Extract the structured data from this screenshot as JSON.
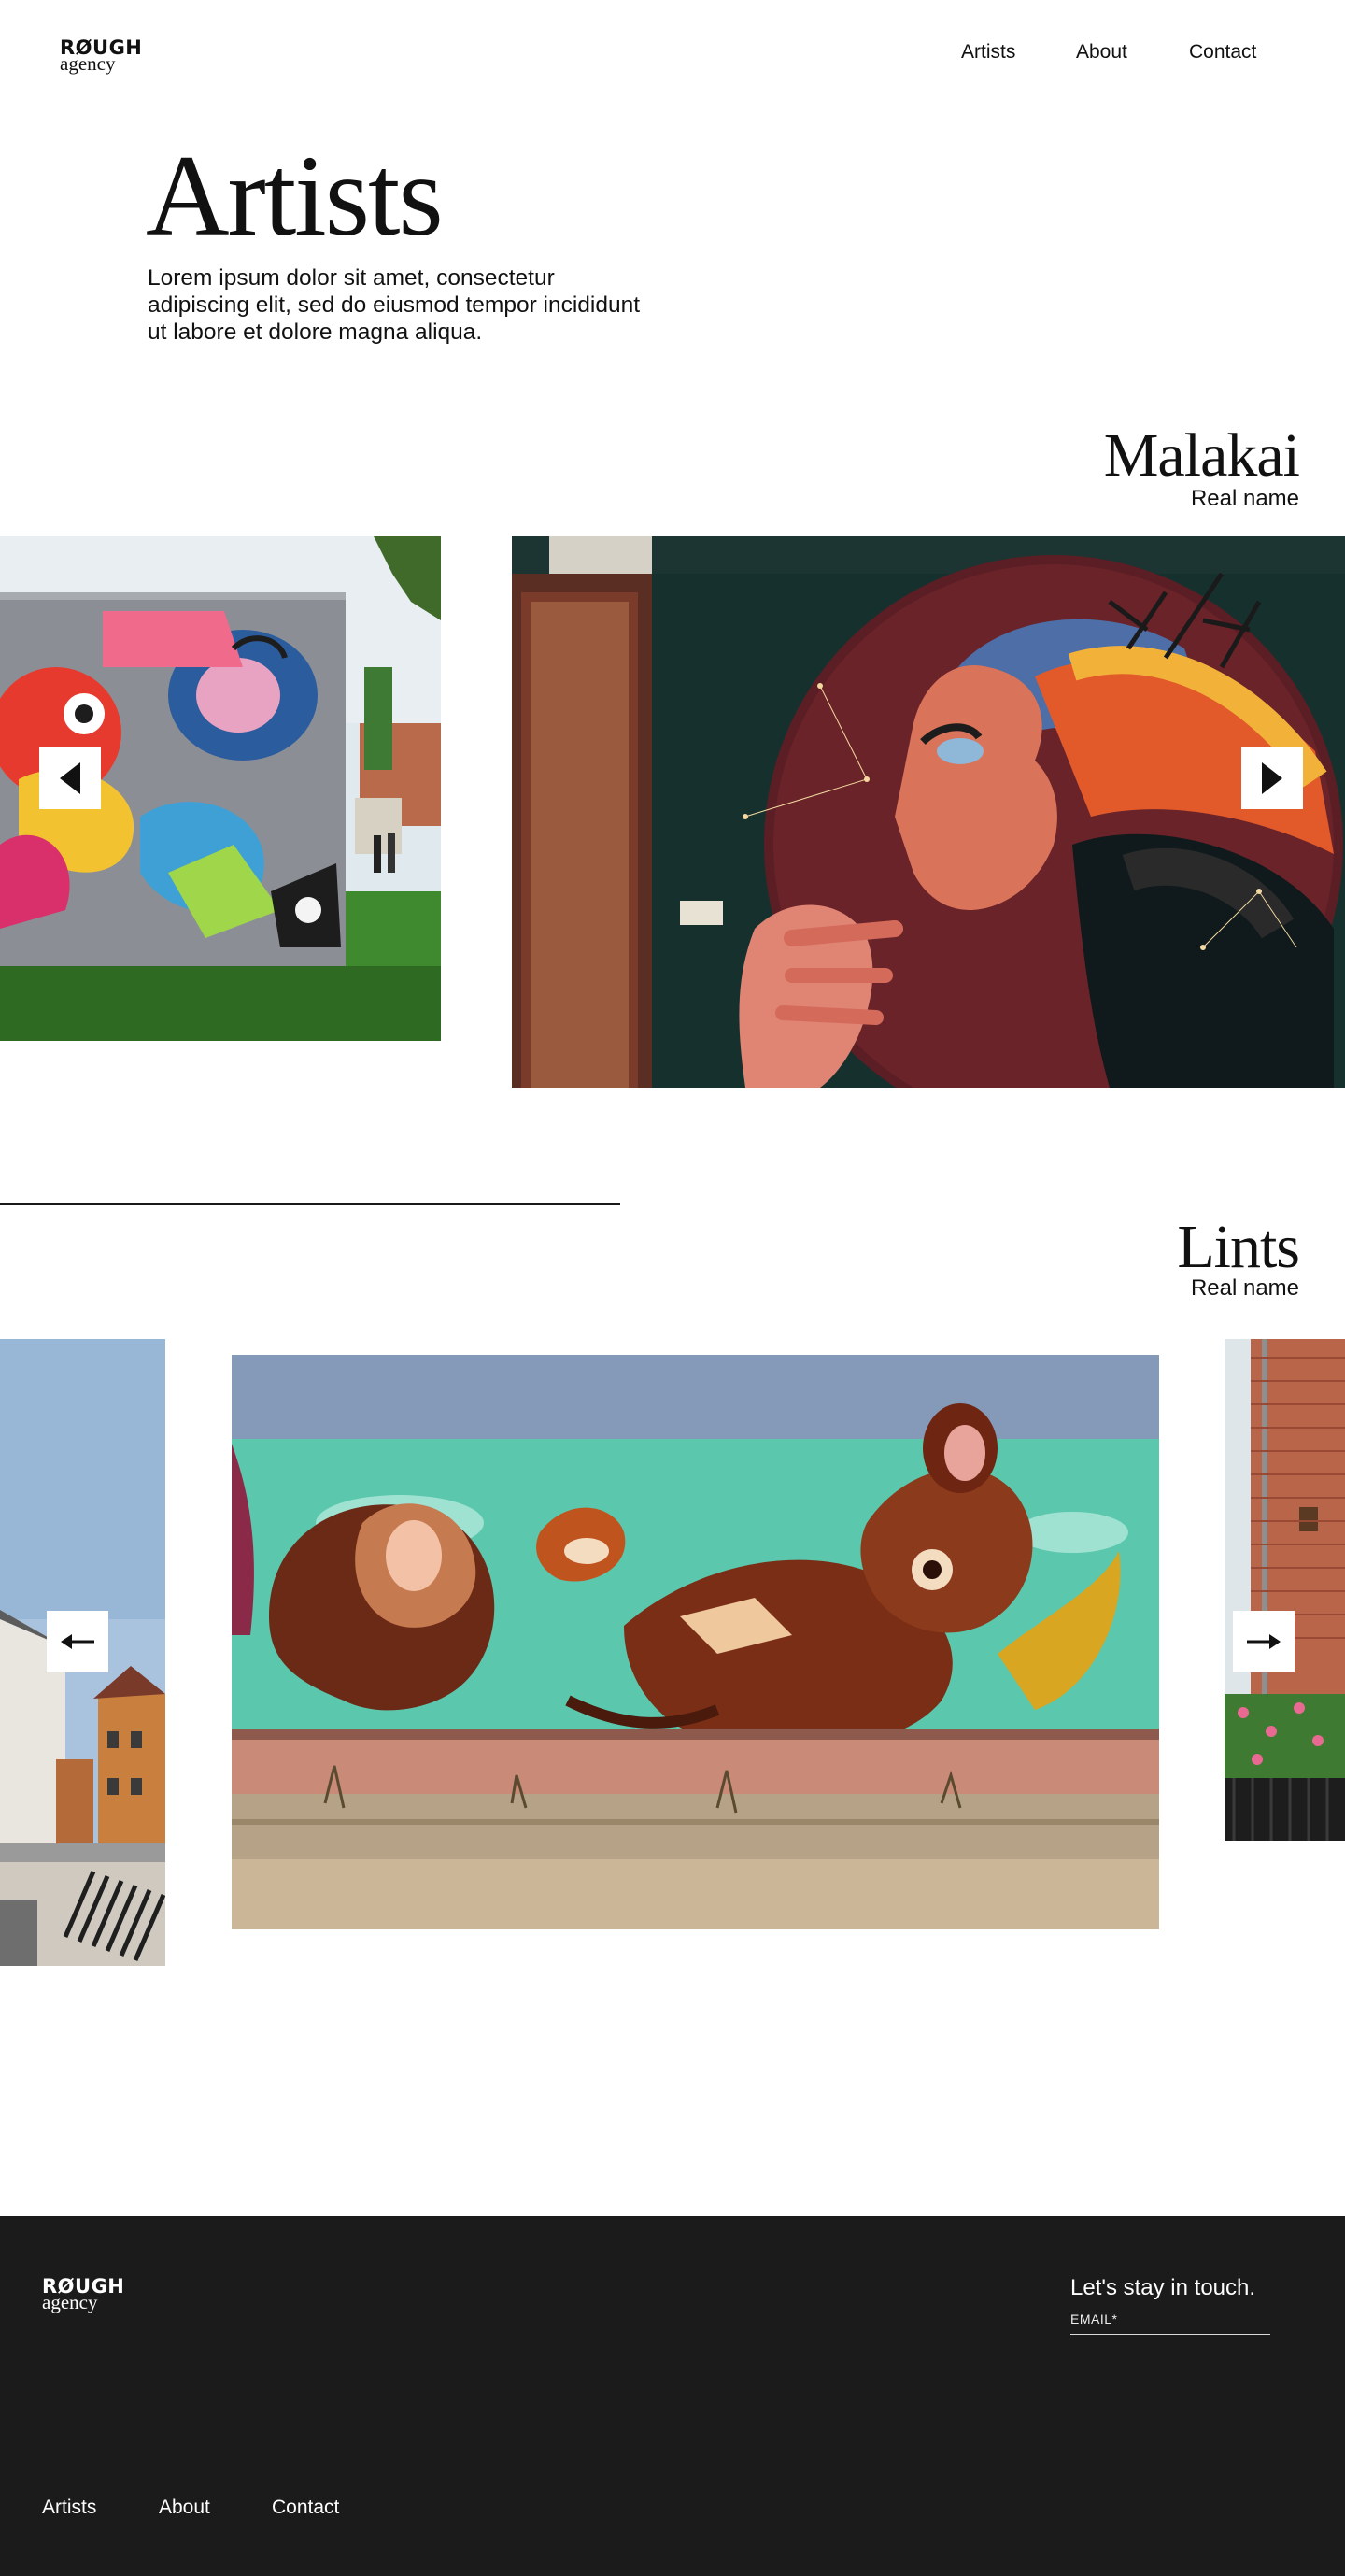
{
  "brand": {
    "logo_top": "RØUGH",
    "logo_bottom": "agency"
  },
  "nav": {
    "artists": "Artists",
    "about": "About",
    "contact": "Contact"
  },
  "page": {
    "title": "Artists",
    "intro": "Lorem ipsum dolor sit amet, consectetur adipiscing elit, sed do eiusmod tempor incididunt ut labore et dolore magna aliqua."
  },
  "artists": [
    {
      "name": "Malakai",
      "real_name": "Real name"
    },
    {
      "name": "Lints",
      "real_name": "Real name"
    }
  ],
  "footer": {
    "logo_top": "RØUGH",
    "logo_bottom": "agency",
    "stay_in_touch": "Let's stay in touch.",
    "email_label": "EMAIL*",
    "nav": {
      "artists": "Artists",
      "about": "About",
      "contact": "Contact"
    }
  },
  "icons": {
    "prev": "triangle-left-icon",
    "next": "triangle-right-icon",
    "prev_alt": "arrow-left-icon",
    "next_alt": "arrow-right-icon"
  },
  "colors": {
    "footer_bg": "#1b1b1b",
    "text": "#111111",
    "background": "#ffffff"
  }
}
